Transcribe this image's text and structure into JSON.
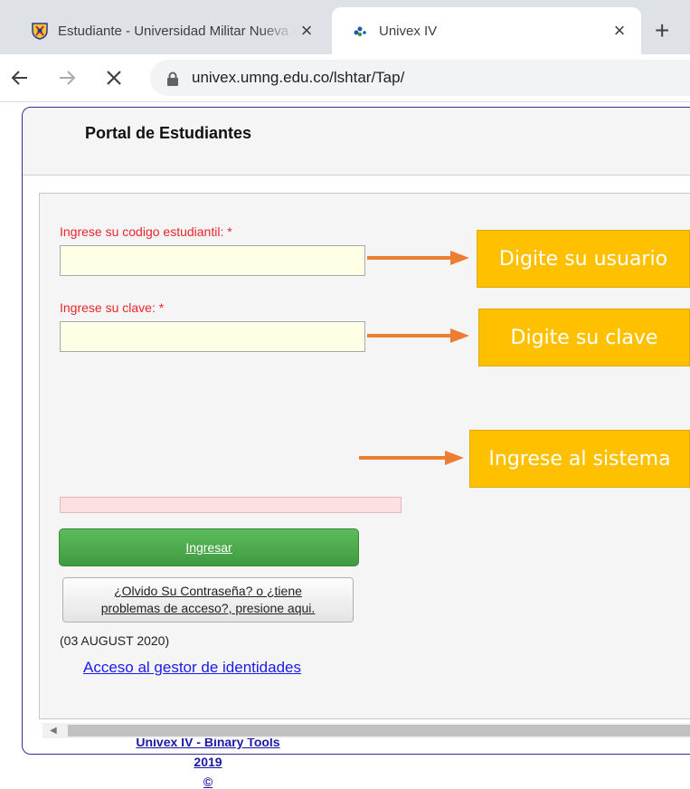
{
  "browser": {
    "tabs": [
      {
        "title": "Estudiante - Universidad Militar Nueva Granada",
        "favicon": "university-shield-icon",
        "active": false
      },
      {
        "title": "Univex IV",
        "favicon": "univex-logo-icon",
        "active": true
      }
    ],
    "new_tab_symbol": "+",
    "close_symbol": "×",
    "url": "univex.umng.edu.co/lshtar/Tap/"
  },
  "page": {
    "title": "Portal de Estudiantes",
    "code_label": "Ingrese su codigo estudiantil: *",
    "code_value": "",
    "password_label": "Ingrese su clave: *",
    "password_value": "",
    "login_button": "Ingresar",
    "forgot_line1": "¿Olvido Su Contraseña? o ¿tiene",
    "forgot_line2": "problemas de acceso?, presione aqui.",
    "date": "(03 AUGUST 2020)",
    "identity_link": "Acceso al gestor de identidades",
    "footer": [
      "Univex IV - Binary Tools",
      "2019",
      "©"
    ]
  },
  "annotations": [
    {
      "text": "Digite su usuario"
    },
    {
      "text": "Digite su clave"
    },
    {
      "text": "Ingrese al sistema"
    }
  ],
  "colors": {
    "callout": "#ffc000",
    "arrow": "#ed7d31",
    "label_red": "#e8262b",
    "button_green": "#4caf50",
    "link_blue": "#1a1aee"
  }
}
